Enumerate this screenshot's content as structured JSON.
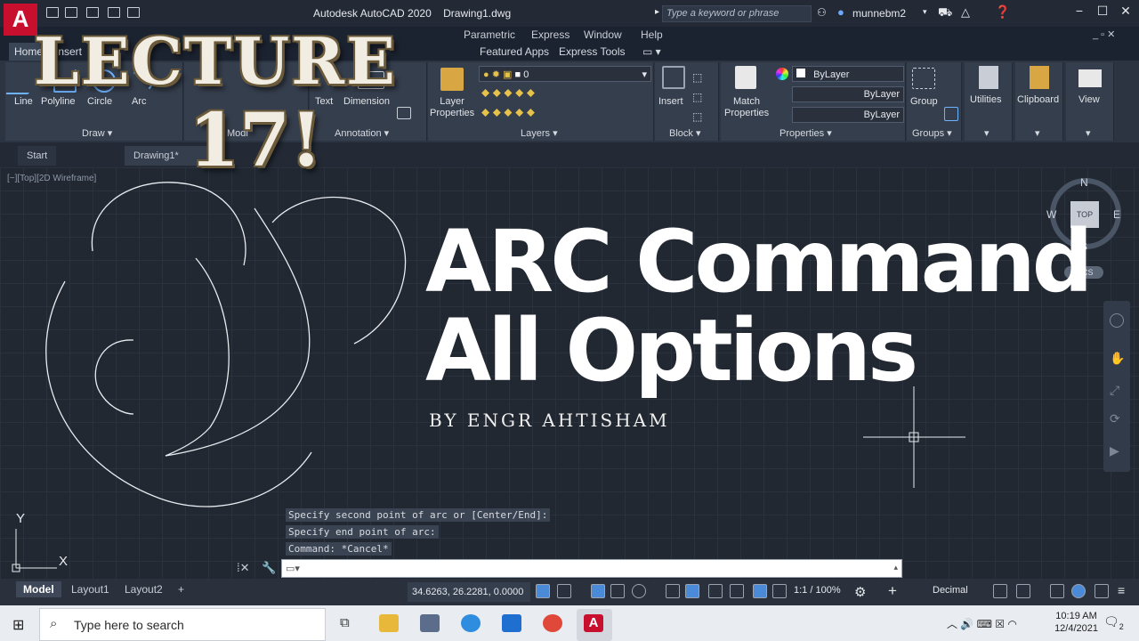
{
  "app": {
    "logo": "A",
    "title": "Autodesk AutoCAD 2020",
    "document": "Drawing1.dwg",
    "search_placeholder": "Type a keyword or phrase",
    "user": "munnebm2"
  },
  "menu": [
    "Parametric",
    "Express",
    "Window",
    "Help"
  ],
  "ribbon_tabs": [
    "Home",
    "Insert",
    "Featured Apps",
    "Express Tools"
  ],
  "ribbon": {
    "draw": {
      "title": "Draw",
      "items": [
        "Line",
        "Polyline",
        "Circle",
        "Arc"
      ]
    },
    "modify": {
      "title": "Modi"
    },
    "annotation": {
      "title": "Annotation",
      "items": [
        "Text",
        "Dimension"
      ]
    },
    "layers": {
      "title": "Layers",
      "layer_properties": "Layer Properties",
      "current_layer": "0"
    },
    "block": {
      "title": "Block",
      "insert": "Insert"
    },
    "properties": {
      "title": "Properties",
      "match": "Match Properties",
      "color": "ByLayer",
      "linetype": "ByLayer",
      "lineweight": "ByLayer"
    },
    "groups": {
      "title": "Groups",
      "group": "Group"
    },
    "utilities": "Utilities",
    "clipboard": "Clipboard",
    "view": "View"
  },
  "doc_tabs": [
    "Start",
    "Drawing1*"
  ],
  "viewport_label": "[−][Top][2D Wireframe]",
  "viewcube": {
    "n": "N",
    "s": "S",
    "e": "E",
    "w": "W",
    "face": "TOP",
    "wcs": "WCS"
  },
  "ucs": {
    "x": "X",
    "y": "Y"
  },
  "overlay": {
    "lecture": "LECTURE",
    "lecture_num": "17!",
    "headline_1": "ARC Command",
    "headline_2": "All Options",
    "byline": "BY ENGR AHTISHAM"
  },
  "command_history": [
    "Specify second point of arc or [Center/End]:",
    "Specify end point of arc:",
    "Command: *Cancel*"
  ],
  "layout_tabs": [
    "Model",
    "Layout1",
    "Layout2"
  ],
  "status": {
    "coords": "34.6263, 26.2281, 0.0000",
    "annoscale": "1:1 / 100%",
    "units": "Decimal"
  },
  "taskbar": {
    "search_placeholder": "Type here to search",
    "time": "10:19 AM",
    "date": "12/4/2021",
    "notifications": "2"
  }
}
